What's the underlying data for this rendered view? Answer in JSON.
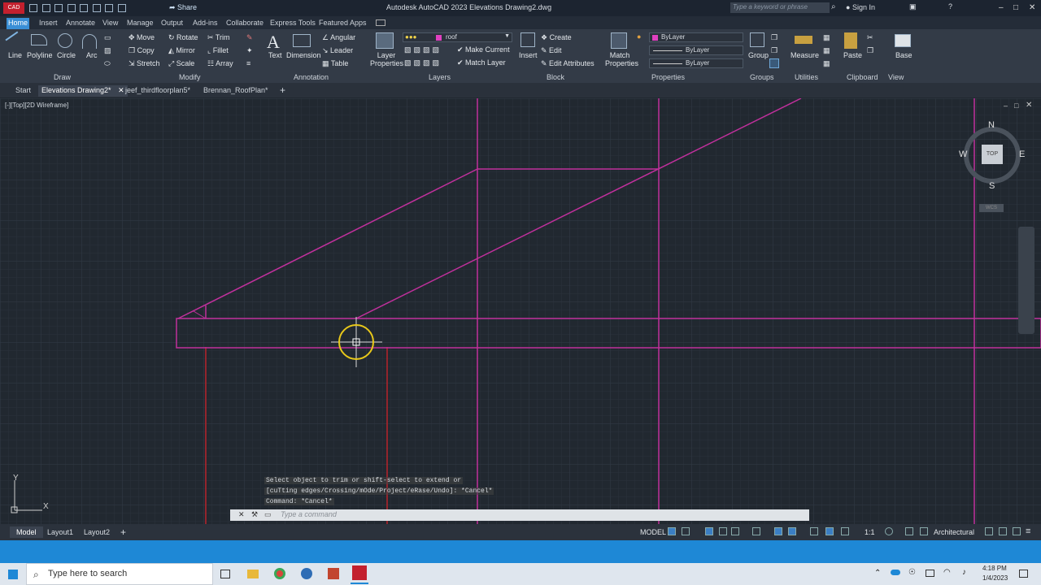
{
  "titlebar": {
    "app_badge": "CAD",
    "title": "Autodesk AutoCAD 2023   Elevations Drawing2.dwg",
    "share_label": "Share",
    "search_placeholder": "Type a keyword or phrase",
    "sign_in": "Sign In"
  },
  "ribbon_tabs": [
    "Home",
    "Insert",
    "Annotate",
    "View",
    "Manage",
    "Output",
    "Add-ins",
    "Collaborate",
    "Express Tools",
    "Featured Apps"
  ],
  "ribbon": {
    "draw": {
      "line": "Line",
      "polyline": "Polyline",
      "circle": "Circle",
      "arc": "Arc",
      "label": "Draw"
    },
    "modify": {
      "move": "Move",
      "rotate": "Rotate",
      "trim": "Trim",
      "copy": "Copy",
      "mirror": "Mirror",
      "fillet": "Fillet",
      "stretch": "Stretch",
      "scale": "Scale",
      "array": "Array",
      "label": "Modify"
    },
    "annotation": {
      "text": "Text",
      "dimension": "Dimension",
      "angular": "Angular",
      "leader": "Leader",
      "table": "Table",
      "label": "Annotation"
    },
    "layers": {
      "properties": "Layer Properties",
      "current_layer": "roof",
      "make_current": "Make Current",
      "match_layer": "Match Layer",
      "label": "Layers"
    },
    "block": {
      "insert": "Insert",
      "create": "Create",
      "edit": "Edit",
      "edit_attributes": "Edit Attributes",
      "label": "Block"
    },
    "properties": {
      "match": "Match Properties",
      "color": "ByLayer",
      "linetype": "ByLayer",
      "lineweight": "ByLayer",
      "label": "Properties"
    },
    "groups": {
      "group": "Group",
      "label": "Groups"
    },
    "utilities": {
      "measure": "Measure",
      "label": "Utilities"
    },
    "clipboard": {
      "paste": "Paste",
      "label": "Clipboard"
    },
    "view": {
      "base": "Base",
      "label": "View"
    }
  },
  "doc_tabs": [
    "Start",
    "Elevations Drawing2*",
    "jeef_thirdfloorplan5*",
    "Brennan_RoofPlan*"
  ],
  "viewport": {
    "label": "[-][Top][2D Wireframe]",
    "viewcube": {
      "n": "N",
      "s": "S",
      "e": "E",
      "w": "W",
      "face": "TOP",
      "wcs": "WCS"
    },
    "ucs_x": "X",
    "ucs_y": "Y"
  },
  "command": {
    "history": [
      "Select object to trim or shift-select to extend or",
      "[cuTting edges/Crossing/mOde/Project/eRase/Undo]: *Cancel*",
      "Command: *Cancel*"
    ],
    "placeholder": "Type a command"
  },
  "layouts": [
    "Model",
    "Layout1",
    "Layout2"
  ],
  "status": {
    "model": "MODEL",
    "scale": "1:1",
    "units": "Architectural"
  },
  "taskbar": {
    "search_placeholder": "Type here to search",
    "time": "4:18 PM",
    "date": "1/4/2023"
  },
  "colors": {
    "magenta": "#c0309c",
    "red": "#b8232a",
    "accent": "#1e88d6",
    "cursor": "#e8c81a"
  }
}
